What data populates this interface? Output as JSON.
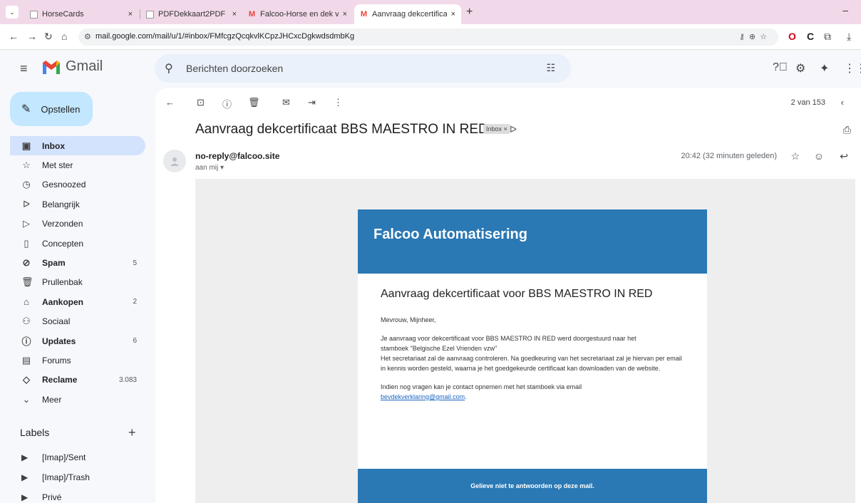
{
  "browser": {
    "tabs": [
      {
        "title": "HorseCards",
        "close": "×",
        "active": false
      },
      {
        "title": "PDFDekkaart2PDF",
        "close": "×",
        "active": false
      },
      {
        "title": "Falcoo-Horse en dek verklaring",
        "close": "×",
        "active": false
      },
      {
        "title": "Aanvraag dekcertificaat BBS M/",
        "close": "×",
        "active": true
      }
    ],
    "tab_menu": "⌄",
    "new_tab": "+",
    "minimize": "–",
    "url": "mail.google.com/mail/u/1/#inbox/FMfcgzQcqkvlKCpzJHCxcDgkwdsdmbKg"
  },
  "gmail": {
    "wordmark": "Gmail",
    "search_placeholder": "Berichten doorzoeken",
    "compose_label": "Opstellen"
  },
  "sidebar": {
    "items": [
      {
        "label": "Inbox",
        "count": "",
        "icon": "inbox-icon"
      },
      {
        "label": "Met ster",
        "count": "",
        "icon": "star-icon"
      },
      {
        "label": "Gesnoozed",
        "count": "",
        "icon": "clock-icon"
      },
      {
        "label": "Belangrijk",
        "count": "",
        "icon": "important-icon"
      },
      {
        "label": "Verzonden",
        "count": "",
        "icon": "send-icon"
      },
      {
        "label": "Concepten",
        "count": "",
        "icon": "draft-icon"
      },
      {
        "label": "Spam",
        "count": "5",
        "icon": "spam-icon"
      },
      {
        "label": "Prullenbak",
        "count": "",
        "icon": "trash-icon"
      },
      {
        "label": "Aankopen",
        "count": "2",
        "icon": "shopping-bag-icon"
      },
      {
        "label": "Sociaal",
        "count": "",
        "icon": "people-icon"
      },
      {
        "label": "Updates",
        "count": "6",
        "icon": "info-icon"
      },
      {
        "label": "Forums",
        "count": "",
        "icon": "forum-icon"
      },
      {
        "label": "Reclame",
        "count": "3.083",
        "icon": "tag-icon"
      },
      {
        "label": "Meer",
        "count": "",
        "icon": "chevron-down-icon"
      }
    ],
    "labels_heading": "Labels",
    "labels": [
      {
        "label": "[Imap]/Sent"
      },
      {
        "label": "[Imap]/Trash"
      },
      {
        "label": "Privé"
      }
    ]
  },
  "message": {
    "pager": "2 van 153",
    "subject": "Aanvraag dekcertificaat BBS MAESTRO IN RED",
    "label_chip": "Inbox ×",
    "sender": "no-reply@falcoo.site",
    "to": "aan mij ▾",
    "time": "20:42 (32 minuten geleden)"
  },
  "email": {
    "banner": "Falcoo Automatisering",
    "heading": "Aanvraag dekcertificaat voor BBS MAESTRO IN RED",
    "greeting": "Mevrouw, Mijnheer,",
    "para1_line1": "Je aanvraag voor dekcertificaat voor BBS MAESTRO IN RED werd doorgestuurd naar het",
    "para1_line2": "stamboek \"Belgische Ezel Vrienden vzw\"",
    "para1_line3": "Het secretariaat zal de aanvraag controleren. Na goedkeuring van het secretariaat zal je hiervan per email in kennis worden gesteld, waarna je het goedgekeurde certificaat kan downloaden van de website.",
    "para2": "Indien nog vragen kan je contact opnemen met het stamboek via email",
    "link": "bevdekverklaring@gmail.com",
    "link_suffix": ".",
    "footer": "Gelieve niet te antwoorden op deze mail."
  },
  "colors": {
    "accent_blue": "#2a78b4",
    "tabstrip": "#f2d9e9",
    "active_nav": "#d3e3fd",
    "compose": "#c2e7ff"
  }
}
